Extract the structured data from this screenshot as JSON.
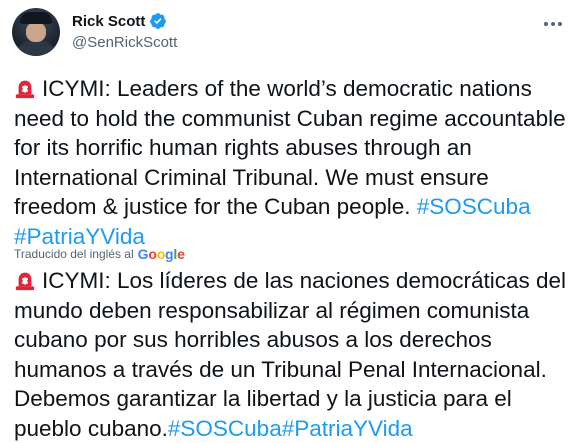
{
  "author": {
    "display_name": "Rick Scott",
    "handle": "@SenRickScott",
    "verified": true
  },
  "tweet": {
    "emoji": "siren-icon",
    "text_main": "ICYMI: Leaders of the world’s democratic nations need to hold the communist Cuban regime accountable for its horrific human rights abuses through an International Criminal Tribunal. We must ensure freedom & justice for the Cuban people.",
    "hashtag_1": "#SOSCuba",
    "hashtag_2": "#PatriaYVida"
  },
  "translation": {
    "label": "Traducido del inglés al",
    "provider_letters": [
      "G",
      "o",
      "o",
      "g",
      "l",
      "e"
    ],
    "emoji": "siren-icon",
    "text_main": "ICYMI: Los líderes de las naciones democráticas del mundo deben responsabilizar al régimen comunista cubano por sus horribles abusos a los derechos humanos a través de un Tribunal Penal Internacional. Debemos garantizar la libertad y la justicia para el pueblo cubano.",
    "hashtag_1": "#SOSCuba",
    "hashtag_2": "#PatriaYVida"
  },
  "colors": {
    "link": "#1d9bf0",
    "verified": "#1d9bf0",
    "secondary_text": "#536471",
    "siren_red": "#e0243a"
  }
}
